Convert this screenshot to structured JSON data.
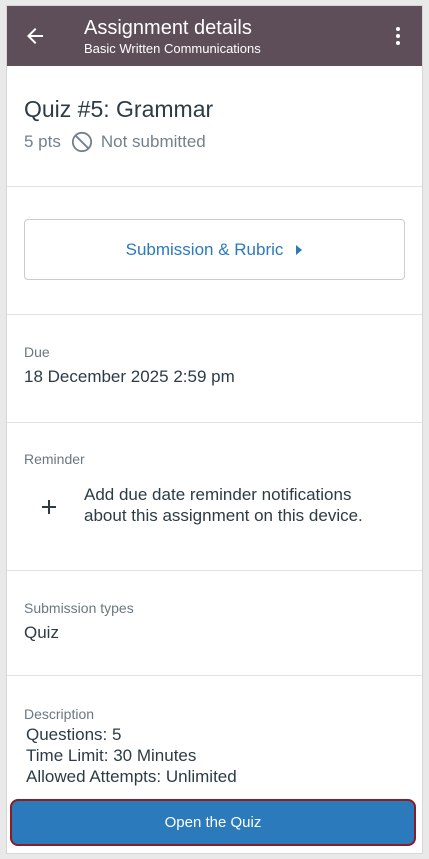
{
  "appbar": {
    "title": "Assignment details",
    "subtitle": "Basic Written Communications"
  },
  "assignment": {
    "title": "Quiz #5: Grammar",
    "points": "5 pts",
    "status": "Not submitted"
  },
  "submission_button": {
    "label": "Submission & Rubric"
  },
  "due": {
    "label": "Due",
    "value": "18 December 2025 2:59 pm"
  },
  "reminder": {
    "label": "Reminder",
    "add_text": "Add due date reminder notifications about this assignment on this device."
  },
  "submission_types": {
    "label": "Submission types",
    "value": "Quiz"
  },
  "description": {
    "label": "Description",
    "lines": [
      "Questions: 5",
      "Time Limit: 30 Minutes",
      "Allowed Attempts: Unlimited"
    ]
  },
  "open_button": {
    "label": "Open the Quiz"
  },
  "colors": {
    "appbar": "#5e4e59",
    "accent": "#2b7abc",
    "highlight_border": "#8a1c24"
  },
  "icons": {
    "back": "arrow-left-icon",
    "menu": "kebab-menu-icon",
    "status": "not-submitted-icon",
    "caret": "caret-right-icon",
    "add": "plus-icon"
  }
}
